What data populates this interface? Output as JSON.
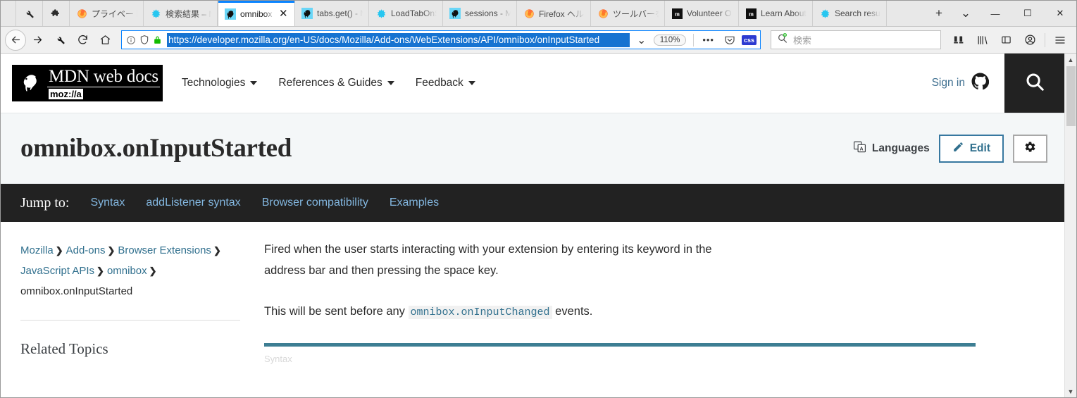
{
  "browser": {
    "toolbar_icons": [
      "wrench-icon",
      "puzzle-icon"
    ],
    "tabs": [
      {
        "label": "プライベートブ",
        "favicon": "firefox-icon",
        "active": false
      },
      {
        "label": "検索結果 – M",
        "favicon": "bugzilla-icon",
        "active": false
      },
      {
        "label": "omnibox",
        "favicon": "mdn-icon",
        "active": true
      },
      {
        "label": "tabs.get() - M",
        "favicon": "mdn-icon",
        "active": false
      },
      {
        "label": "LoadTabOnS",
        "favicon": "bugzilla-icon",
        "active": false
      },
      {
        "label": "sessions - M",
        "favicon": "mdn-icon",
        "active": false
      },
      {
        "label": "Firefox ヘルプ",
        "favicon": "firefox-icon",
        "active": false
      },
      {
        "label": "ツールバーをカ",
        "favicon": "firefox-icon",
        "active": false
      },
      {
        "label": "Volunteer O",
        "favicon": "mozilla-m-icon",
        "active": false
      },
      {
        "label": "Learn About",
        "favicon": "mozilla-m-icon",
        "active": false
      },
      {
        "label": "Search resul",
        "favicon": "bugzilla-icon",
        "active": false
      }
    ],
    "new_tab_label": "+",
    "tab_list_label": "⌄",
    "window_controls": {
      "minimize": "—",
      "maximize": "☐",
      "close": "✕"
    },
    "nav": {
      "back": "←",
      "forward": "→",
      "customize": "wrench-icon",
      "reload": "⟳",
      "home": "⌂"
    },
    "urlbar": {
      "url": "https://developer.mozilla.org/en-US/docs/Mozilla/Add-ons/WebExtensions/API/omnibox/onInputStarted",
      "identity_icon": "info-icon",
      "tracking_icon": "shield-icon",
      "lock_icon": "padlock-icon",
      "dropmarker": "⌄",
      "zoom_level": "110%",
      "page_actions": "•••",
      "pocket_icon": "pocket-icon",
      "css_badge": "css"
    },
    "search": {
      "placeholder": "検索",
      "icon": "search-plus-icon"
    },
    "toolbar_right": [
      "containers-icon",
      "library-icon",
      "sidebar-icon",
      "account-icon",
      "hamburger-menu-icon"
    ]
  },
  "site": {
    "logo": {
      "line1": "MDN web docs",
      "line2": "moz://a",
      "mascot": "dino-icon"
    },
    "nav": [
      {
        "label": "Technologies"
      },
      {
        "label": "References & Guides"
      },
      {
        "label": "Feedback"
      }
    ],
    "sign_in": {
      "label": "Sign in",
      "icon": "github-icon"
    },
    "search_button_icon": "search-icon"
  },
  "page": {
    "title": "omnibox.onInputStarted",
    "actions": {
      "languages_label": "Languages",
      "languages_icon": "translate-icon",
      "edit_label": "Edit",
      "edit_icon": "pencil-icon",
      "settings_icon": "gear-icon"
    },
    "jump_to": {
      "label": "Jump to:",
      "links": [
        "Syntax",
        "addListener syntax",
        "Browser compatibility",
        "Examples"
      ]
    },
    "breadcrumbs": {
      "links": [
        "Mozilla",
        "Add-ons",
        "Browser Extensions",
        "JavaScript APIs",
        "omnibox"
      ],
      "separator": "❯",
      "current": "omnibox.onInputStarted"
    },
    "sidebar_heading": "Related Topics",
    "body": {
      "paragraph1": "Fired when the user starts interacting with your extension by entering its keyword in the address bar and then pressing the space key.",
      "paragraph2_before": "This will be sent before any ",
      "paragraph2_code": "omnibox.onInputChanged",
      "paragraph2_after": " events.",
      "section_heading_partial": "Syntax"
    }
  },
  "colors": {
    "accent_blue": "#0a84ff",
    "link_blue": "#31708e",
    "jump_link": "#83b7e0",
    "dark_bar": "#222222",
    "title_bg": "#f4f7f8",
    "teal_rule": "#3d7e93",
    "url_selection": "#1673d1"
  }
}
